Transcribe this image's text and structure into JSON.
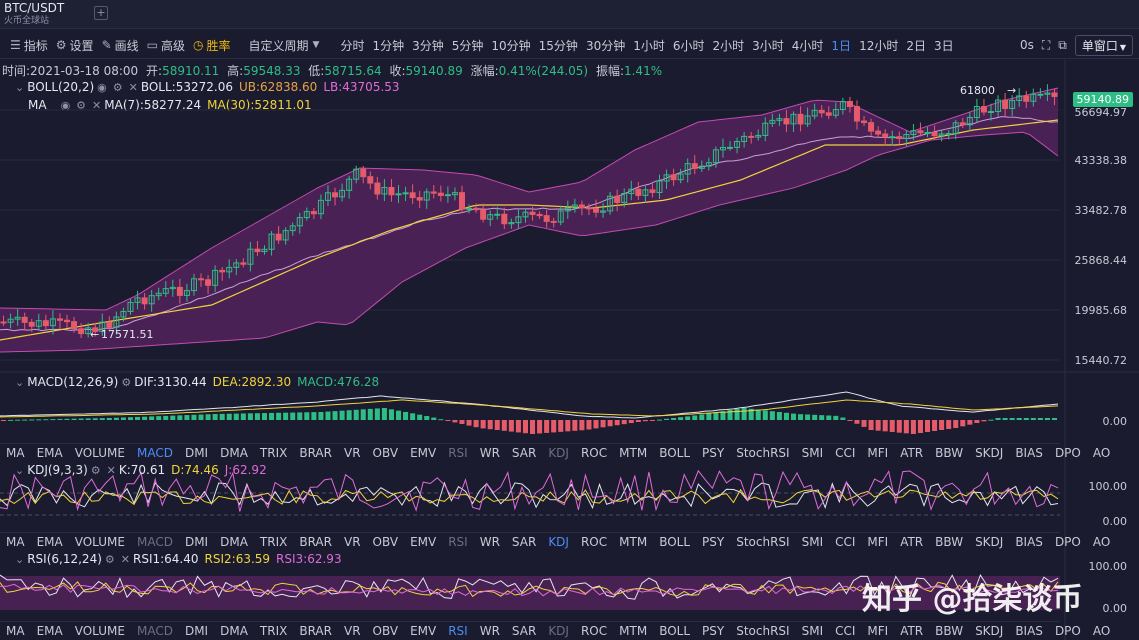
{
  "symbol": {
    "pair": "BTC/USDT",
    "exchange": "火币全球站",
    "add_tab": "+"
  },
  "toolbar": {
    "indicators": "指标",
    "settings": "设置",
    "draw": "画线",
    "advanced": "高级",
    "winrate": "胜率",
    "custom_period": "自定义周期",
    "periods": [
      "分时",
      "1分钟",
      "3分钟",
      "5分钟",
      "10分钟",
      "15分钟",
      "30分钟",
      "1小时",
      "6小时",
      "2小时",
      "3小时",
      "4小时",
      "1日",
      "12小时",
      "2日",
      "3日"
    ],
    "active_period": "1日",
    "countdown": "0s",
    "window_mode": "单窗口"
  },
  "info": {
    "time_label": "时间:",
    "time": "2021-03-18 08:00",
    "open_label": "开:",
    "open": "58910.11",
    "high_label": "高:",
    "high": "59548.33",
    "low_label": "低:",
    "low": "58715.64",
    "close_label": "收:",
    "close": "59140.89",
    "change_label": "涨幅:",
    "change": "0.41%(244.05)",
    "amplitude_label": "振幅:",
    "amplitude": "1.41%"
  },
  "boll": {
    "name": "BOLL(20,2)",
    "boll": "BOLL:53272.06",
    "ub": "UB:62838.60",
    "lb": "LB:43705.53"
  },
  "ma": {
    "name": "MA",
    "ma7": "MA(7):58277.24",
    "ma30": "MA(30):52811.01"
  },
  "price_axis": {
    "ticks": [
      "56694.97",
      "43338.38",
      "33482.78",
      "25868.44",
      "19985.68",
      "15440.72"
    ],
    "current": "59140.89"
  },
  "annotations": {
    "high": "61800",
    "low": "17571.51"
  },
  "macd": {
    "name": "MACD(12,26,9)",
    "dif": "DIF:3130.44",
    "dea": "DEA:2892.30",
    "macd": "MACD:476.28",
    "axis": "0.00"
  },
  "kdj": {
    "name": "KDJ(9,3,3)",
    "k": "K:70.61",
    "d": "D:74.46",
    "j": "J:62.92",
    "axis": [
      "100.00",
      "0.00"
    ]
  },
  "rsi": {
    "name": "RSI(6,12,24)",
    "rsi1": "RSI1:64.40",
    "rsi2": "RSI2:63.59",
    "rsi3": "RSI3:62.93",
    "axis": [
      "100.00",
      "0.00"
    ]
  },
  "indicator_tabs": [
    "MA",
    "EMA",
    "VOLUME",
    "MACD",
    "DMI",
    "DMA",
    "TRIX",
    "BRAR",
    "VR",
    "OBV",
    "EMV",
    "RSI",
    "WR",
    "SAR",
    "KDJ",
    "ROC",
    "MTM",
    "BOLL",
    "PSY",
    "StochRSI",
    "SMI",
    "CCI",
    "MFI",
    "ATR",
    "BBW",
    "SKDJ",
    "BIAS",
    "DPO",
    "AO"
  ],
  "tabs_row1_active": "MACD",
  "tabs_row1_dim": [
    "RSI",
    "KDJ"
  ],
  "tabs_row2_active": "KDJ",
  "tabs_row2_dim": [
    "MACD",
    "RSI"
  ],
  "tabs_row3_active": "RSI",
  "tabs_row3_dim": [
    "MACD",
    "KDJ"
  ],
  "watermark": "知乎 @拾柒谈币",
  "colors": {
    "up": "#2ebd85",
    "down": "#e55b6a",
    "band": "#5a2462",
    "accent": "#4c8df5",
    "highlight": "#f0b90b"
  }
}
